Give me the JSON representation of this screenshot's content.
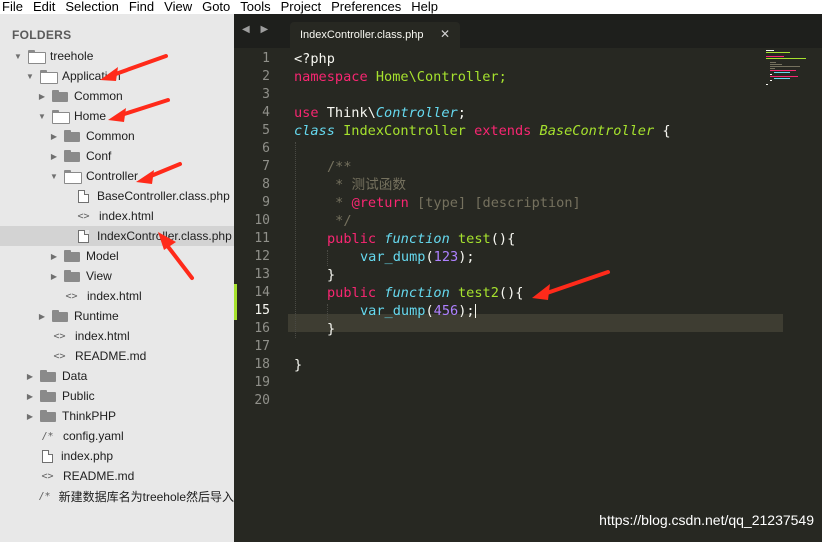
{
  "menu": [
    "File",
    "Edit",
    "Selection",
    "Find",
    "View",
    "Goto",
    "Tools",
    "Project",
    "Preferences",
    "Help"
  ],
  "sidebar": {
    "title": "FOLDERS",
    "items": [
      {
        "label": "treehole",
        "icon": "folder-open-icon"
      },
      {
        "label": "Application",
        "icon": "folder-open-icon"
      },
      {
        "label": "Common",
        "icon": "folder-icon"
      },
      {
        "label": "Home",
        "icon": "folder-open-icon"
      },
      {
        "label": "Common",
        "icon": "folder-icon"
      },
      {
        "label": "Conf",
        "icon": "folder-icon"
      },
      {
        "label": "Controller",
        "icon": "folder-open-icon"
      },
      {
        "label": "BaseController.class.php",
        "icon": "file-icon"
      },
      {
        "label": "index.html",
        "icon": "code-file-icon"
      },
      {
        "label": "IndexController.class.php",
        "icon": "file-icon"
      },
      {
        "label": "Model",
        "icon": "folder-icon"
      },
      {
        "label": "View",
        "icon": "folder-icon"
      },
      {
        "label": "index.html",
        "icon": "code-file-icon"
      },
      {
        "label": "Runtime",
        "icon": "folder-icon"
      },
      {
        "label": "index.html",
        "icon": "code-file-icon"
      },
      {
        "label": "README.md",
        "icon": "code-file-icon"
      },
      {
        "label": "Data",
        "icon": "folder-icon"
      },
      {
        "label": "Public",
        "icon": "folder-icon"
      },
      {
        "label": "ThinkPHP",
        "icon": "folder-icon"
      },
      {
        "label": "config.yaml",
        "icon": "comment-file-icon"
      },
      {
        "label": "index.php",
        "icon": "file-icon"
      },
      {
        "label": "README.md",
        "icon": "code-file-icon"
      },
      {
        "label": "新建数据库名为treehole然后导入",
        "icon": "comment-file-icon"
      }
    ]
  },
  "editor": {
    "tab_title": "IndexController.class.php",
    "tab_close": "✕",
    "current_line": 15,
    "line_numbers": [
      "1",
      "2",
      "3",
      "4",
      "5",
      "6",
      "7",
      "8",
      "9",
      "10",
      "11",
      "12",
      "13",
      "14",
      "15",
      "16",
      "17",
      "18",
      "19",
      "20"
    ],
    "code": {
      "l1": "<?php",
      "l2_kw": "namespace",
      "l2_ns": "Home\\Controller;",
      "l4_kw": "use",
      "l4_a": "Think\\",
      "l4_b": "Controller",
      "l4_c": ";",
      "l5_kw": "class",
      "l5_name": "IndexController",
      "l5_ext": "extends",
      "l5_parent": "BaseController",
      "l5_brace": "{",
      "l7": "/**",
      "l8": " * 测试函数",
      "l9_a": " * ",
      "l9_b": "@return",
      "l9_c": " [type] [description]",
      "l10": " */",
      "l11_pub": "public",
      "l11_fn": "function",
      "l11_name": "test",
      "l11_rest": "(){",
      "l12_call": "var_dump",
      "l12_open": "(",
      "l12_num": "123",
      "l12_close": ");",
      "l13": "}",
      "l14_pub": "public",
      "l14_fn": "function",
      "l14_name": "test2",
      "l14_rest": "(){",
      "l15_call": "var_dump",
      "l15_open": "(",
      "l15_num": "456",
      "l15_close": ");",
      "l16": "}",
      "l18": "}"
    }
  },
  "watermark": "https://blog.csdn.net/qq_21237549",
  "colors": {
    "annotation_arrow": "#ff2a1a",
    "editor_bg": "#272822",
    "sidebar_bg": "#e8e8e8"
  }
}
